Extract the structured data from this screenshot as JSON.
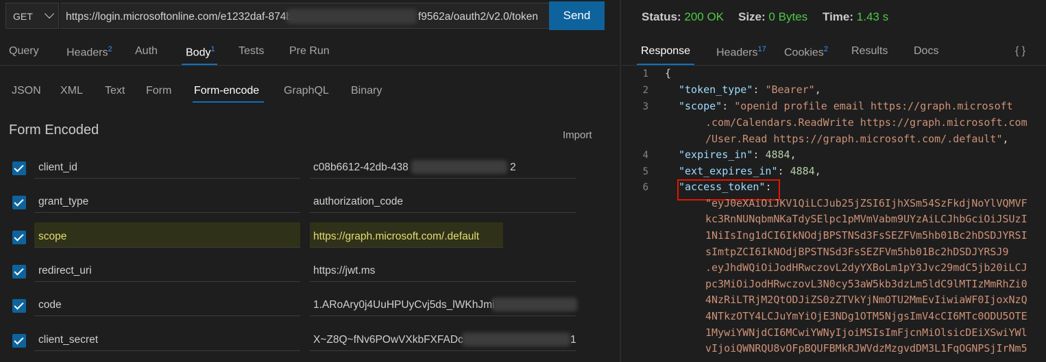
{
  "request": {
    "method": "GET",
    "url": "https://login.microsoftonline.com/e1232daf-874b-4                     f9562a/oauth2/v2.0/token",
    "url_parts": [
      "https://login.microsoftonline.com/e1232daf-874b-4",
      "f9562a/oauth2/v2.0/token"
    ],
    "send_label": "Send"
  },
  "request_tabs": [
    {
      "label": "Query",
      "badge": ""
    },
    {
      "label": "Headers",
      "badge": "2"
    },
    {
      "label": "Auth",
      "badge": ""
    },
    {
      "label": "Body",
      "badge": "1",
      "active": true
    },
    {
      "label": "Tests",
      "badge": ""
    },
    {
      "label": "Pre Run",
      "badge": ""
    }
  ],
  "body_tabs": [
    "JSON",
    "XML",
    "Text",
    "Form",
    "Form-encode",
    "GraphQL",
    "Binary"
  ],
  "body_active": "Form-encode",
  "form": {
    "title": "Form Encoded",
    "import_label": "Import",
    "rows": [
      {
        "key": "client_id",
        "value": "c08b6612-42db-438",
        "tail": "2",
        "checked": true
      },
      {
        "key": "grant_type",
        "value": "authorization_code",
        "tail": "",
        "checked": true
      },
      {
        "key": "scope",
        "value": "https://graph.microsoft.com/.default",
        "tail": "",
        "checked": true,
        "highlight": true
      },
      {
        "key": "redirect_uri",
        "value": "https://jwt.ms",
        "tail": "",
        "checked": true
      },
      {
        "key": "code",
        "value": "1.ARoAry0j4UuHPUyCvj5ds_lWKhJmi",
        "tail": "",
        "checked": true
      },
      {
        "key": "client_secret",
        "value": "X~Z8Q~fNv6POwVXkbFXFADc",
        "tail": "1",
        "checked": true
      }
    ]
  },
  "response": {
    "status_label": "Status:",
    "status_value": "200 OK",
    "size_label": "Size:",
    "size_value": "0 Bytes",
    "time_label": "Time:",
    "time_value": "1.43 s",
    "tabs": [
      {
        "label": "Response",
        "badge": "",
        "active": true
      },
      {
        "label": "Headers",
        "badge": "17"
      },
      {
        "label": "Cookies",
        "badge": "2"
      },
      {
        "label": "Results",
        "badge": ""
      },
      {
        "label": "Docs",
        "badge": ""
      }
    ],
    "format_icon": "{ }",
    "line_numbers": [
      "1",
      "2",
      "3",
      "4",
      "5",
      "6"
    ],
    "json": {
      "open_brace": "{",
      "token_type_key": "\"token_type\"",
      "token_type_val": "\"Bearer\"",
      "scope_key": "\"scope\"",
      "scope_val_1": "\"openid profile email https://graph.microsoft",
      "scope_val_2": ".com/Calendars.ReadWrite https://graph.microsoft.com",
      "scope_val_3": "/User.Read https://graph.microsoft.com/.default\"",
      "expires_in_key": "\"expires_in\"",
      "expires_in_val": "4884",
      "ext_expires_in_key": "\"ext_expires_in\"",
      "ext_expires_in_val": "4884",
      "access_token_key": "\"access_token\"",
      "access_token_lines": [
        "\"eyJ0eXAiOiJKV1QiLCJub25jZSI6IjhXSm54SzFkdjNoYlVQMVF",
        "kc3RnNUNqbmNKaTdySElpc1pMVmVabm9UYzAiLCJhbGciOiJSUzI",
        "1NiIsIng1dCI6IkNOdjBPSTNSd3FsSEZFVm5hb01Bc2hDSDJYRSI",
        "sImtpZCI6IkNOdjBPSTNSd3FsSEZFVm5hb01Bc2hDSDJYRSJ9",
        ".eyJhdWQiOiJodHRwczovL2dyYXBoLm1pY3Jvc29mdC5jb20iLCJ",
        "pc3MiOiJodHRwczovL3N0cy53aW5kb3dzLm5ldC9lMTIzMmRhZi0",
        "4NzRiLTRjM2QtODJiZS0zZTVkYjNmOTU2MmEvIiwiaWF0IjoxNzQ",
        "4NTkzOTY4LCJuYmYiOjE3NDg1OTM5NjgsImV4cCI6MTc0ODU5OTE",
        "1MywiYWNjdCI6MCwiYWNyIjoiMSIsImFjcnMiOlsicDEiXSwiYWl",
        "vIjoiQWNRQU8vOFpBQUFBMkRJWVdzMzgvdDM3L1FqOGNPSjIrNm5"
      ]
    }
  }
}
